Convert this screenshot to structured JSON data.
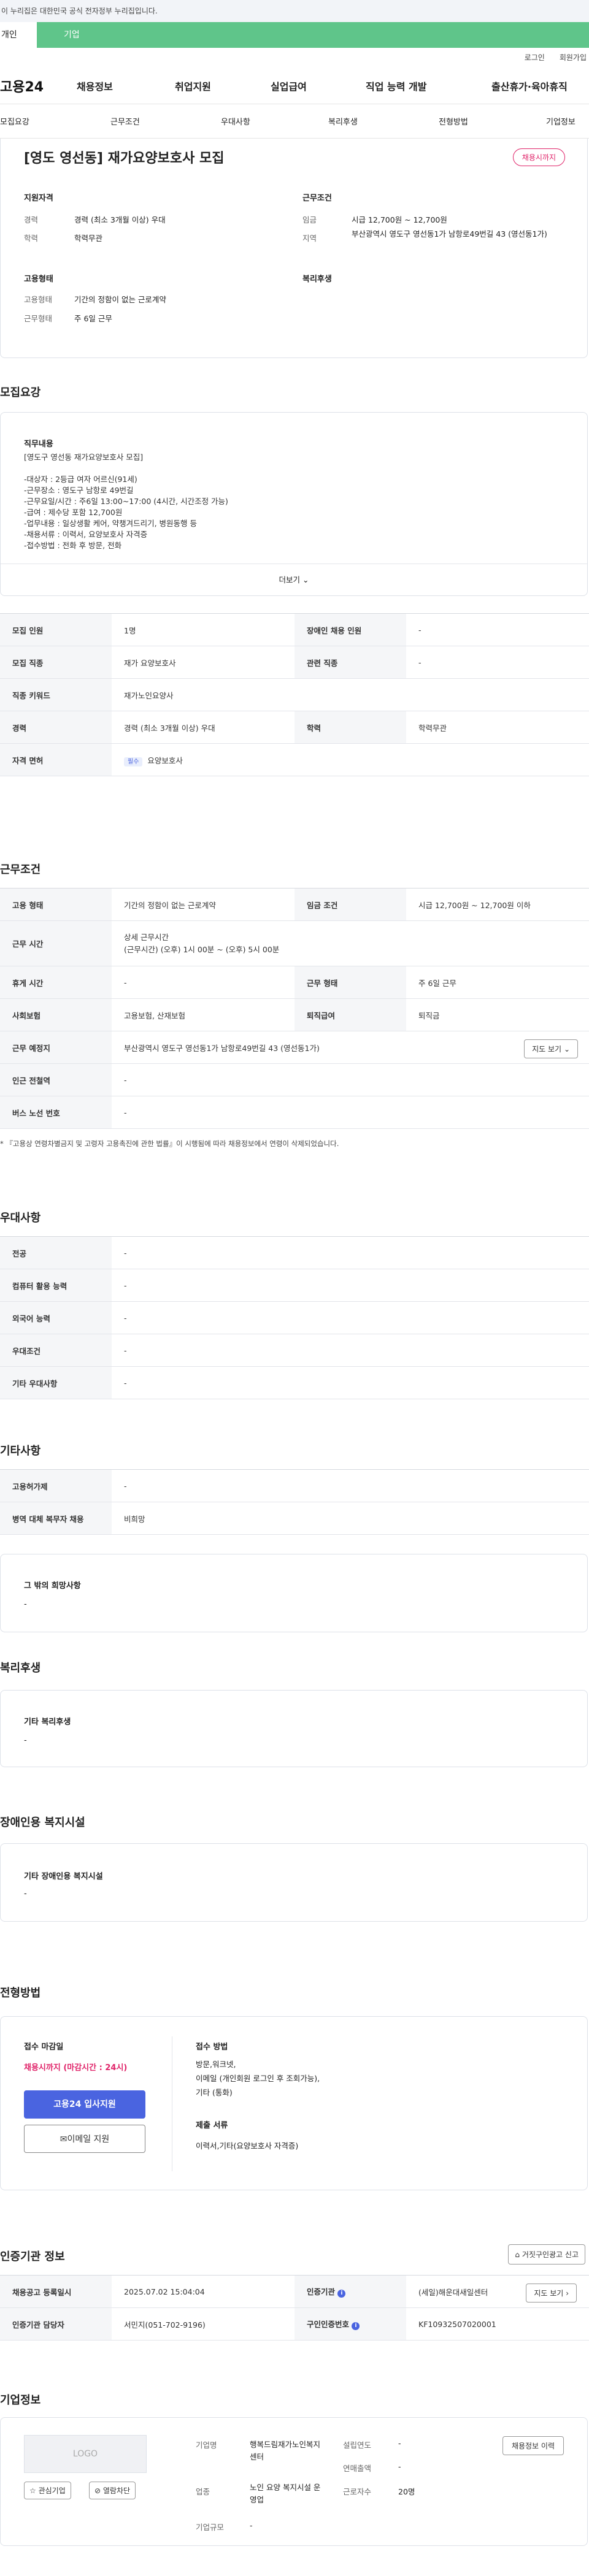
{
  "gov_bar": "이 누리집은 대한민국 공식 전자정부 누리집입니다.",
  "tabs": [
    "개인",
    "기업"
  ],
  "util": {
    "login": "로그인",
    "join": "회원가입"
  },
  "gnb": {
    "logo": "고용24",
    "items": [
      "채용정보",
      "취업지원",
      "실업급여",
      "직업 능력 개발",
      "출산휴가·육아휴직"
    ]
  },
  "subnav": [
    "모집요강",
    "근무조건",
    "우대사항",
    "복리후생",
    "전형방법",
    "기업정보"
  ],
  "header": {
    "title": "[영도 영선동] 재가요양보호사 모집",
    "badge": "채용시까지",
    "left": {
      "group1": "지원자격",
      "rows1": [
        {
          "k": "경력",
          "v": "경력 (최소 3개월 이상) 우대"
        },
        {
          "k": "학력",
          "v": "학력무관"
        }
      ],
      "group2": "고용형태",
      "rows2": [
        {
          "k": "고용형태",
          "v": "기간의 정함이 없는 근로계약"
        },
        {
          "k": "근무형태",
          "v": "주 6일 근무"
        }
      ]
    },
    "right": {
      "group1": "근무조건",
      "rows1": [
        {
          "k": "임금",
          "v": "시급 12,700원 ~ 12,700원"
        },
        {
          "k": "지역",
          "v": "부산광역시 영도구 영선동1가 남항로49번길 43 (영선동1가)"
        }
      ],
      "group2": "복리후생"
    }
  },
  "recruit": {
    "title": "모집요강",
    "job_label": "직무내용",
    "job_lines": [
      "[영도구 영선동 재가요양보호사 모집]",
      "",
      "-대상자 : 2등급 여자 어르신(91세)",
      "-근무장소 : 영도구 남항로 49번길",
      "-근무요일/시간 : 주6일 13:00~17:00 (4시간, 시간조정 가능)",
      "-급여 :  제수당 포함 12,700원",
      "-업무내용 : 일상생활 케어, 약챙겨드리기, 병원동행 등",
      "-채용서류 : 이력서, 요양보호사 자격증",
      "-접수방법 : 전화 후 방문, 전화"
    ],
    "more": "더보기",
    "table": [
      [
        {
          "th": "모집 인원",
          "v": "1명"
        },
        {
          "th": "장애인 채용 인원",
          "v": "-"
        }
      ],
      [
        {
          "th": "모집 직종",
          "v": "재가 요양보호사"
        },
        {
          "th": "관련 직종",
          "v": "-"
        }
      ],
      [
        {
          "th": "직종 키워드",
          "v": "재가노인요양사"
        }
      ],
      [
        {
          "th": "경력",
          "v": "경력 (최소 3개월 이상) 우대"
        },
        {
          "th": "학력",
          "v": "학력무관"
        }
      ],
      [
        {
          "th": "자격 면허",
          "v": "요양보호사",
          "pill": "필수"
        }
      ]
    ]
  },
  "work": {
    "title": "근무조건",
    "table": [
      [
        {
          "th": "고용 형태",
          "v": "기간의 정함이 없는 근로계약"
        },
        {
          "th": "임금 조건",
          "v": "시급 12,700원 ~ 12,700원 이하"
        }
      ],
      [
        {
          "th": "근무 시간",
          "v1": "상세 근무시간",
          "v2": "(근무시간) (오후) 1시 00분 ~ (오후) 5시 00분"
        }
      ],
      [
        {
          "th": "휴게 시간",
          "v": "-"
        },
        {
          "th": "근무 형태",
          "v": "주 6일 근무"
        }
      ],
      [
        {
          "th": "사회보험",
          "v": "고용보험, 산재보험"
        },
        {
          "th": "퇴직급여",
          "v": "퇴직금"
        }
      ],
      [
        {
          "th": "근무 예정지",
          "v": "부산광역시 영도구 영선동1가 남항로49번길 43 (영선동1가)",
          "btn": "지도 보기"
        }
      ],
      [
        {
          "th": "인근 전철역",
          "v": "-"
        }
      ],
      [
        {
          "th": "버스 노선 번호",
          "v": "-"
        }
      ]
    ],
    "note": "* 『고용상 연령차별금지 및 고령자 고용촉진에 관한 법률』이 시행됨에 따라 채용정보에서 연령이 삭제되었습니다."
  },
  "pref": {
    "title": "우대사항",
    "table": [
      {
        "th": "전공",
        "v": "-"
      },
      {
        "th": "컴퓨터 활용 능력",
        "v": "-"
      },
      {
        "th": "외국어 능력",
        "v": "-"
      },
      {
        "th": "우대조건",
        "v": "-"
      },
      {
        "th": "기타 우대사항",
        "v": "-"
      }
    ]
  },
  "etc": {
    "title": "기타사항",
    "table": [
      {
        "th": "고용허가제",
        "v": "-"
      },
      {
        "th": "병역 대체 복무자 채용",
        "v": "비희망"
      }
    ],
    "box_label": "그 밖의 희망사항",
    "box_value": "-"
  },
  "welfare": {
    "title": "복리후생",
    "box_label": "기타 복리후생",
    "box_value": "-"
  },
  "disabled": {
    "title": "장애인용 복지시설",
    "box_label": "기타 장애인용 복지시설",
    "box_value": "-"
  },
  "process": {
    "title": "전형방법",
    "deadline_label": "접수 마감일",
    "deadline_value": "채용시까지 (마감시간 : 24시)",
    "apply_btn": "고용24 입사지원",
    "email_btn": "이메일 지원",
    "method_label": "접수 방법",
    "method_lines": [
      "방문,워크넷,",
      "이메일 (개인회원 로그인 후 조회가능),",
      "기타 (통화)"
    ],
    "docs_label": "제출 서류",
    "docs_value": "이력서,기타(요양보호사 자격증)"
  },
  "cert": {
    "title": "인증기관 정보",
    "report_btn": "거짓구인광고 신고",
    "rows": [
      [
        {
          "th": "채용공고 등록일시",
          "v": "2025.07.02 15:04:04"
        },
        {
          "th": "인증기관",
          "v": "(세일)해운대새일센터",
          "btn": "지도 보기"
        }
      ],
      [
        {
          "th": "인증기관 담당자",
          "v": "서민지(051-702-9196)"
        },
        {
          "th": "구인인증번호",
          "v": "KF10932507020001"
        }
      ]
    ]
  },
  "company": {
    "title": "기업정보",
    "logo": "LOGO",
    "fav": "관심기업",
    "block": "열람차단",
    "k1": "기업명",
    "v1": "행복드림재가노인복지센터",
    "k2": "업종",
    "v2": "노인 요양 복지시설 운영업",
    "k3": "기업규모",
    "v3": "-",
    "k4": "설립연도",
    "v4": "-",
    "k5": "연매출액",
    "v5": "-",
    "k6": "근로자수",
    "v6": "20명",
    "history_btn": "채용정보 이력"
  }
}
